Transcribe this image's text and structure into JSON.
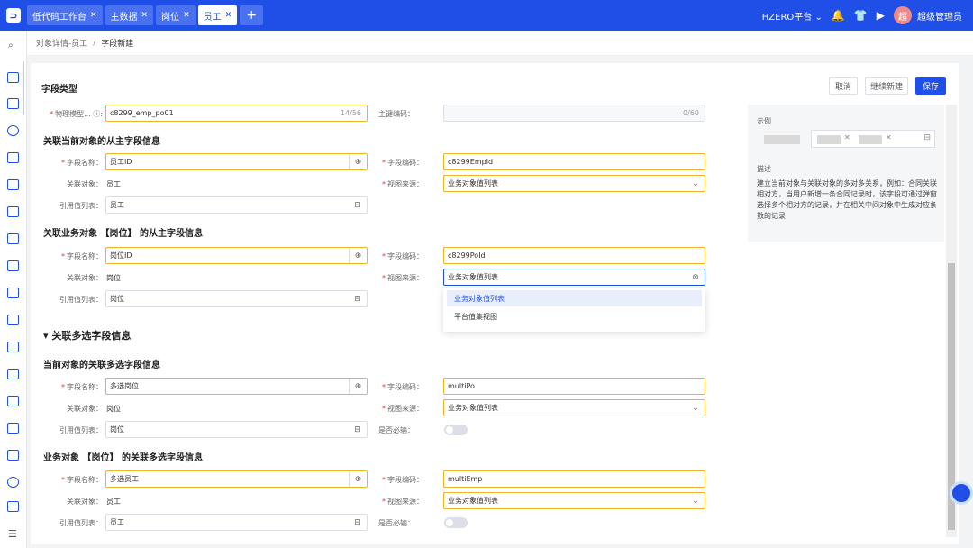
{
  "topbar": {
    "tabs": [
      {
        "label": "低代码工作台"
      },
      {
        "label": "主数据"
      },
      {
        "label": "岗位"
      },
      {
        "label": "员工"
      }
    ],
    "add_label": "+",
    "platform": "HZERO平台",
    "avatar_text": "超",
    "user": "超级管理员"
  },
  "breadcrumb": {
    "parent": "对象详情-员工",
    "sep": "/",
    "current": "字段新建"
  },
  "actions": {
    "cancel": "取消",
    "continue": "继续新建",
    "save": "保存"
  },
  "field_type": {
    "title": "字段类型",
    "physical_model_label": "物理模型...",
    "physical_model_value": "c8299_emp_po01",
    "physical_model_count": "14/56",
    "pk_label": "主键编码：",
    "pk_count": "0/60"
  },
  "sec1": {
    "title": "关联当前对象的从主字段信息",
    "name_label": "字段名称：",
    "name_value": "员工ID",
    "code_label": "字段编码：",
    "code_value": "c8299EmpId",
    "obj_label": "关联对象：",
    "obj_value": "员工",
    "view_label": "视图来源：",
    "view_value": "业务对象值列表",
    "ref_label": "引用值列表：",
    "ref_value": "员工"
  },
  "sec2": {
    "title": "关联业务对象 【岗位】 的从主字段信息",
    "name_label": "字段名称：",
    "name_value": "岗位ID",
    "code_label": "字段编码：",
    "code_value": "c8299PoId",
    "obj_label": "关联对象：",
    "obj_value": "岗位",
    "view_label": "视图来源：",
    "view_value": "业务对象值列表",
    "ref_label": "引用值列表：",
    "ref_value": "岗位",
    "dropdown": [
      "业务对象值列表",
      "平台值集视图"
    ]
  },
  "multi": {
    "title": "关联多选字段信息"
  },
  "sec3": {
    "title": "当前对象的关联多选字段信息",
    "name_label": "字段名称：",
    "name_value": "多选岗位",
    "code_label": "字段编码：",
    "code_value": "multiPo",
    "obj_label": "关联对象：",
    "obj_value": "岗位",
    "view_label": "视图来源：",
    "view_value": "业务对象值列表",
    "ref_label": "引用值列表：",
    "ref_value": "岗位",
    "req_label": "是否必输："
  },
  "sec4": {
    "title": "业务对象 【岗位】 的关联多选字段信息",
    "name_label": "字段名称：",
    "name_value": "多选员工",
    "code_label": "字段编码：",
    "code_value": "multiEmp",
    "obj_label": "关联对象：",
    "obj_value": "员工",
    "view_label": "视图来源：",
    "view_value": "业务对象值列表",
    "ref_label": "引用值列表：",
    "ref_value": "员工",
    "req_label": "是否必输："
  },
  "panel": {
    "example_label": "示例",
    "desc_label": "描述",
    "desc": "建立当前对象与关联对象的多对多关系，例如：合同关联相对方，当用户新增一条合同记录时，该字段可通过弹窗选择多个相对方的记录，并在相关中间对象中生成对应条数的记录"
  },
  "colors": {
    "brand": "#1f4fe6",
    "highlight": "#f0b429",
    "required": "#e53935"
  }
}
